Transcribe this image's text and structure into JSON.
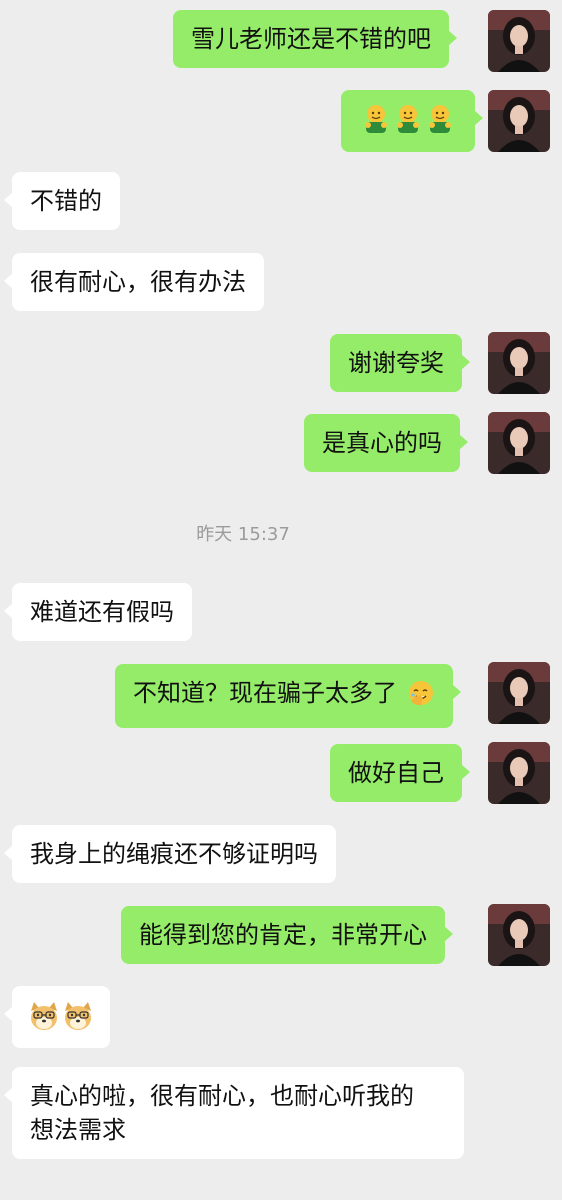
{
  "timestamp": "昨天 15:37",
  "messages": [
    {
      "side": "sent",
      "text": "雪儿老师还是不错的吧"
    },
    {
      "side": "sent",
      "emoji": "hug-emoji",
      "emoji_count": 3
    },
    {
      "side": "recv",
      "text": "不错的"
    },
    {
      "side": "recv",
      "text": "很有耐心，很有办法"
    },
    {
      "side": "sent",
      "text": "谢谢夸奖"
    },
    {
      "side": "sent",
      "text": "是真心的吗"
    },
    {
      "side": "recv",
      "text": "难道还有假吗"
    },
    {
      "side": "sent",
      "text": "不知道？现在骗子太多了",
      "trailing_emoji": "facepalm-emoji"
    },
    {
      "side": "sent",
      "text": "做好自己"
    },
    {
      "side": "recv",
      "text": "我身上的绳痕还不够证明吗"
    },
    {
      "side": "sent",
      "text": "能得到您的肯定，非常开心"
    },
    {
      "side": "recv",
      "emoji": "doge-emoji",
      "emoji_count": 2
    },
    {
      "side": "recv",
      "lines": [
        "真心的啦，很有耐心，也耐心听我的",
        "想法需求"
      ]
    }
  ],
  "colors": {
    "background": "#ededed",
    "sent_bubble": "#95ec69",
    "recv_bubble": "#ffffff",
    "timestamp": "#9b9b9b"
  }
}
